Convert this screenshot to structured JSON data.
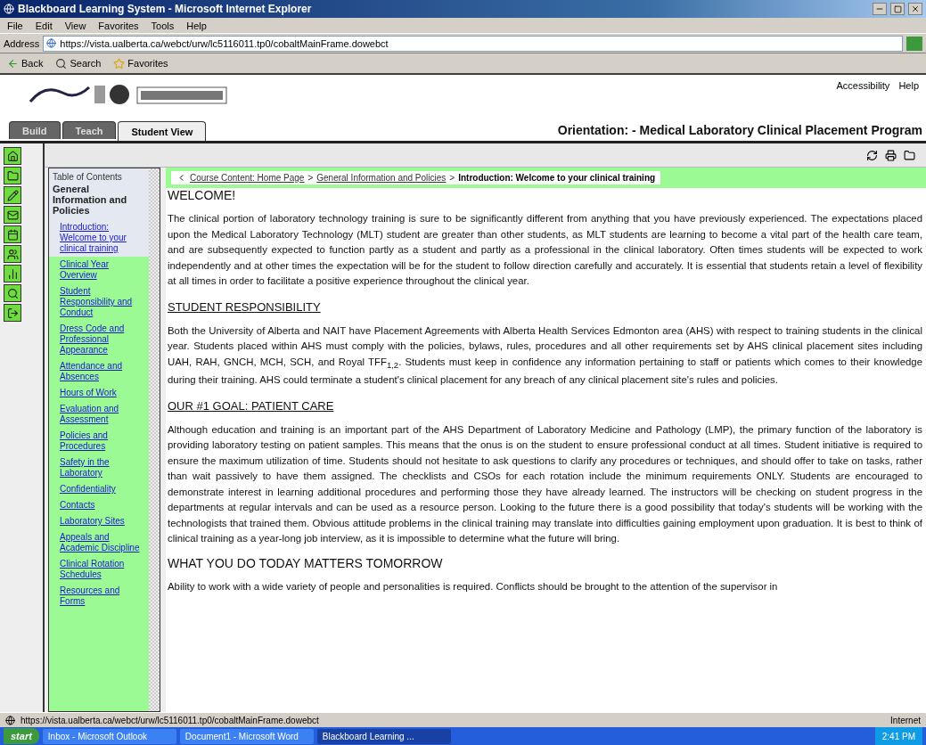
{
  "window": {
    "title": "Blackboard Learning System - Microsoft Internet Explorer"
  },
  "menu": [
    "File",
    "Edit",
    "View",
    "Favorites",
    "Tools",
    "Help"
  ],
  "address": {
    "label": "Address",
    "url": "https://vista.ualberta.ca/webct/urw/lc5116011.tp0/cobaltMainFrame.dowebct"
  },
  "toolbar": [
    {
      "kind": "back",
      "label": "Back"
    },
    {
      "kind": "search",
      "label": "Search"
    },
    {
      "kind": "favorites",
      "label": "Favorites"
    }
  ],
  "header": {
    "links": [
      "Accessibility",
      "Help"
    ],
    "course_title": "Orientation: - Medical Laboratory Clinical Placement Program"
  },
  "tabs": [
    {
      "label": "Build",
      "selected": false
    },
    {
      "label": "Teach",
      "selected": false
    },
    {
      "label": "Student View",
      "selected": true
    }
  ],
  "side_tools": [
    {
      "kind": "home"
    },
    {
      "kind": "folder"
    },
    {
      "kind": "pencil"
    },
    {
      "kind": "mail"
    },
    {
      "kind": "calendar"
    },
    {
      "kind": "users"
    },
    {
      "kind": "chart"
    },
    {
      "kind": "search"
    },
    {
      "kind": "logout"
    }
  ],
  "toc": {
    "title": "Table of Contents",
    "section": "General Information and Policies",
    "items": [
      {
        "text": "Introduction: Welcome to your clinical training",
        "selected": true
      },
      {
        "text": "Clinical Year Overview",
        "selected": false
      },
      {
        "text": "Student Responsibility and Conduct",
        "selected": false
      },
      {
        "text": "Dress Code and Professional Appearance",
        "selected": false
      },
      {
        "text": "Attendance and Absences",
        "selected": false
      },
      {
        "text": "Hours of Work",
        "selected": false
      },
      {
        "text": "Evaluation and Assessment",
        "selected": false
      },
      {
        "text": "Policies and Procedures",
        "selected": false
      },
      {
        "text": "Safety in the Laboratory",
        "selected": false
      },
      {
        "text": "Confidentiality",
        "selected": false
      },
      {
        "text": "Contacts",
        "selected": false
      },
      {
        "text": "Laboratory Sites",
        "selected": false
      },
      {
        "text": "Appeals and Academic Discipline",
        "selected": false
      },
      {
        "text": "Clinical Rotation Schedules",
        "selected": false
      },
      {
        "text": "Resources and Forms",
        "selected": false
      }
    ]
  },
  "breadcrumb": [
    {
      "text": "Course Content: Home Page",
      "link": true
    },
    {
      "kind": "separator",
      "text": ">"
    },
    {
      "text": "General Information and Policies",
      "link": true
    },
    {
      "kind": "separator",
      "text": ">"
    },
    {
      "text": "Introduction: Welcome to your clinical training",
      "link": false
    }
  ],
  "content": [
    {
      "kind": "heading",
      "text": "WELCOME!"
    },
    {
      "kind": "paragraph",
      "text": "The clinical portion of laboratory technology training is sure to be significantly different from anything that you have previously experienced. The expectations placed upon the Medical Laboratory Technology (MLT) student are greater than other students, as MLT students are learning to become a vital part of the health care team, and are subsequently expected to function partly as a student and partly as a professional in the clinical laboratory. Often times students will be expected to work independently and at other times the expectation will be for the student to follow direction carefully and accurately. It is essential that students retain a level of flexibility at all times in order to facilitate a positive experience throughout the clinical year."
    },
    {
      "kind": "section",
      "text": "STUDENT RESPONSIBILITY"
    },
    {
      "kind": "paragraph",
      "text": "Both the University of Alberta and NAIT have Placement Agreements with Alberta Health Services Edmonton area (AHS) with respect to training students in the clinical year. Students placed within AHS must comply with the policies, bylaws, rules, procedures and all other requirements set by AHS clinical placement sites including UAH, RAH, GNCH, MCH, SCH, and Royal TFF$_{1,2}$. Students must keep in confidence any information pertaining to staff or patients which comes to their knowledge during their training. AHS could terminate a student's clinical placement for any breach of any clinical placement site's rules and policies."
    },
    {
      "kind": "section",
      "text": "OUR #1 GOAL: PATIENT CARE"
    },
    {
      "kind": "paragraph",
      "text": "Although education and training is an important part of the AHS Department of Laboratory Medicine and Pathology (LMP), the primary function of the laboratory is providing laboratory testing on patient samples. This means that the onus is on the student to ensure professional conduct at all times. Student initiative is required to ensure the maximum utilization of time. Students should not hesitate to ask questions to clarify any procedures or techniques, and should offer to take on tasks, rather than wait passively to have them assigned. The checklists and CSOs for each rotation include the minimum requirements ONLY. Students are encouraged to demonstrate interest in learning additional procedures and performing those they have already learned. The instructors will be checking on student progress in the departments at regular intervals and can be used as a resource person. Looking to the future there is a good possibility that today's students will be working with the technologists that trained them. Obvious attitude problems in the clinical training may translate into difficulties gaining employment upon graduation. It is best to think of clinical training as a year-long job interview, as it is impossible to determine what the future will bring."
    },
    {
      "kind": "heading",
      "text": "WHAT YOU DO TODAY MATTERS TOMORROW"
    },
    {
      "kind": "paragraph",
      "text": "Ability to work with a wide variety of people and personalities is required. Conflicts should be brought to the attention of the supervisor in"
    }
  ],
  "status_bar": {
    "url": "https://vista.ualberta.ca/webct/urw/lc5116011.tp0/cobaltMainFrame.dowebct",
    "zone": "Internet"
  },
  "taskbar": {
    "start": "start",
    "tasks": [
      {
        "label": "Inbox - Microsoft Outlook",
        "selected": false
      },
      {
        "label": "Document1 - Microsoft Word",
        "selected": false
      },
      {
        "label": "Blackboard Learning ...",
        "selected": true
      }
    ],
    "clock": "2:41 PM"
  }
}
